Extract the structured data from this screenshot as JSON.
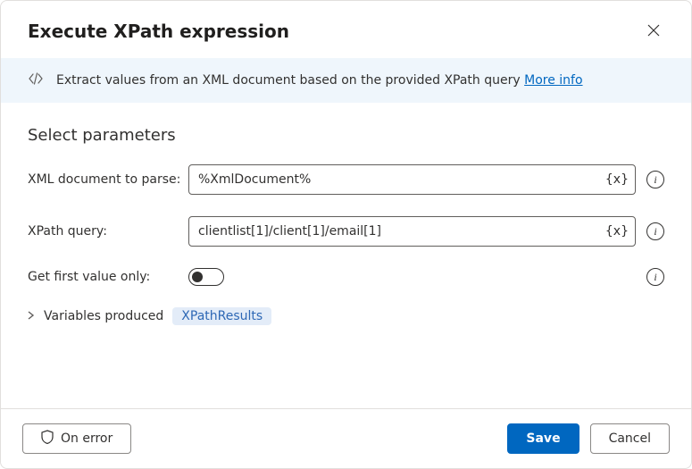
{
  "header": {
    "title": "Execute XPath expression"
  },
  "infoBar": {
    "text": "Extract values from an XML document based on the provided XPath query ",
    "linkText": "More info"
  },
  "section": {
    "title": "Select parameters"
  },
  "params": {
    "xmlDoc": {
      "label": "XML document to parse:",
      "value": "%XmlDocument%"
    },
    "xpath": {
      "label": "XPath query:",
      "value": "clientlist[1]/client[1]/email[1]"
    },
    "firstOnly": {
      "label": "Get first value only:"
    }
  },
  "variables": {
    "label": "Variables produced",
    "chip": "XPathResults"
  },
  "footer": {
    "onError": "On error",
    "save": "Save",
    "cancel": "Cancel"
  },
  "tokens": {
    "varBadge": "{x}"
  }
}
